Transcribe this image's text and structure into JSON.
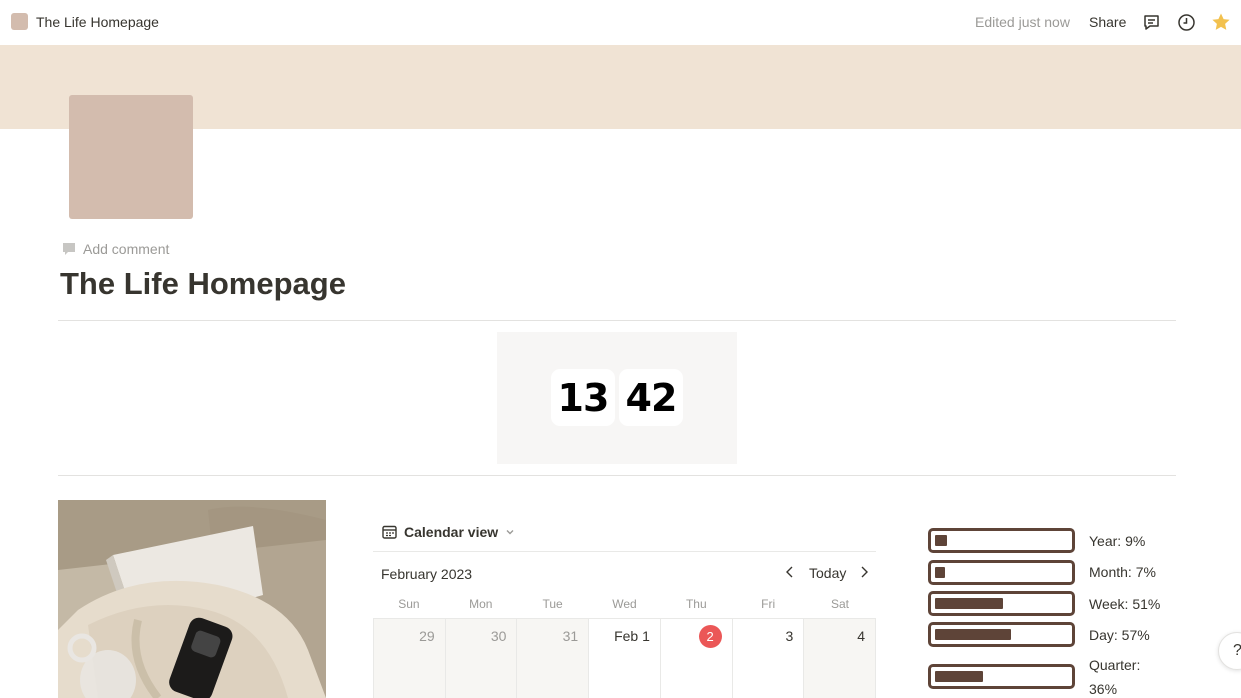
{
  "topbar": {
    "title": "The Life Homepage",
    "edited": "Edited just now",
    "share": "Share",
    "icons": [
      "comment-icon",
      "clock-history-icon",
      "star-icon"
    ],
    "star_color": "#f2c14e"
  },
  "cover": {
    "color": "#f0e3d4",
    "icon_color": "#d3bcae"
  },
  "add_comment": "Add comment",
  "page_title": "The Life Homepage",
  "clock": {
    "hours": "13",
    "minutes": "42"
  },
  "calendar": {
    "view_label": "Calendar view",
    "month": "February 2023",
    "today_label": "Today",
    "weekdays": [
      "Sun",
      "Mon",
      "Tue",
      "Wed",
      "Thu",
      "Fri",
      "Sat"
    ],
    "days": [
      "29",
      "30",
      "31",
      "Feb 1",
      "2",
      "3",
      "4"
    ],
    "today_index": 4,
    "today_color": "#eb5757"
  },
  "progress": [
    {
      "label": "Year: 9%",
      "value": 0.09
    },
    {
      "label": "Month: 7%",
      "value": 0.07
    },
    {
      "label": "Week: 51%",
      "value": 0.51
    },
    {
      "label": "Day: 57%",
      "value": 0.57
    },
    {
      "label": "Quarter: 36%",
      "value": 0.36
    }
  ],
  "progress_color": "#5e4438",
  "help": "?"
}
